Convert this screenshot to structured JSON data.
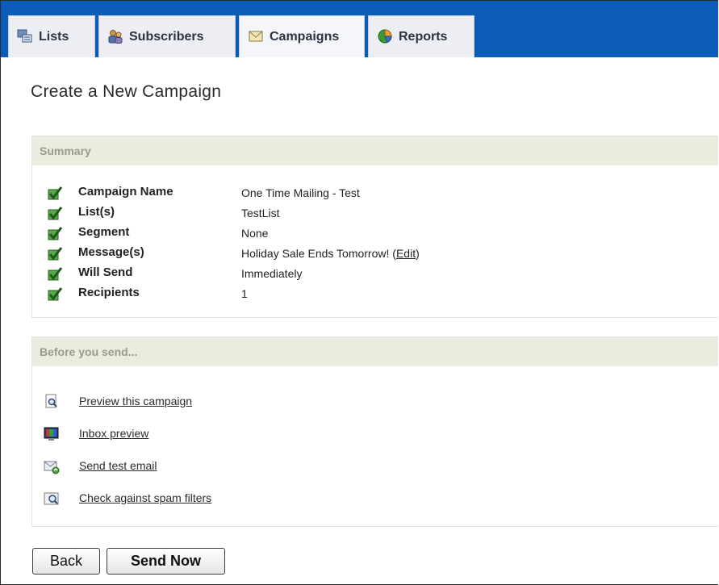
{
  "tabs": [
    {
      "label": "Lists",
      "icon": "lists-icon"
    },
    {
      "label": "Subscribers",
      "icon": "subscribers-icon"
    },
    {
      "label": "Campaigns",
      "icon": "campaigns-icon",
      "active": true
    },
    {
      "label": "Reports",
      "icon": "reports-icon"
    }
  ],
  "page": {
    "title": "Create a New Campaign"
  },
  "summary": {
    "heading": "Summary",
    "rows": [
      {
        "label": "Campaign Name",
        "value": "One Time Mailing - Test"
      },
      {
        "label": "List(s)",
        "value": "TestList"
      },
      {
        "label": "Segment",
        "value": "None"
      },
      {
        "label": "Message(s)",
        "value": "Holiday Sale Ends Tomorrow!",
        "edit_open": "(",
        "edit_link": "Edit",
        "edit_close": ")"
      },
      {
        "label": "Will Send",
        "value": "Immediately"
      },
      {
        "label": "Recipients",
        "value": "1"
      }
    ]
  },
  "before_send": {
    "heading": "Before you send...",
    "actions": [
      {
        "label": "Preview this campaign",
        "icon": "preview-magnifier-icon"
      },
      {
        "label": "Inbox preview",
        "icon": "inbox-preview-monitor-icon"
      },
      {
        "label": "Send test email",
        "icon": "send-test-email-icon"
      },
      {
        "label": "Check against spam filters",
        "icon": "spam-filter-check-icon"
      }
    ]
  },
  "buttons": {
    "back": "Back",
    "send_now": "Send Now"
  },
  "colors": {
    "tab_bar": "#0a5cb8",
    "panel_header": "#ecebdf",
    "panel_header_text": "#9a9a8e",
    "check_green": "#3c8a2e"
  }
}
